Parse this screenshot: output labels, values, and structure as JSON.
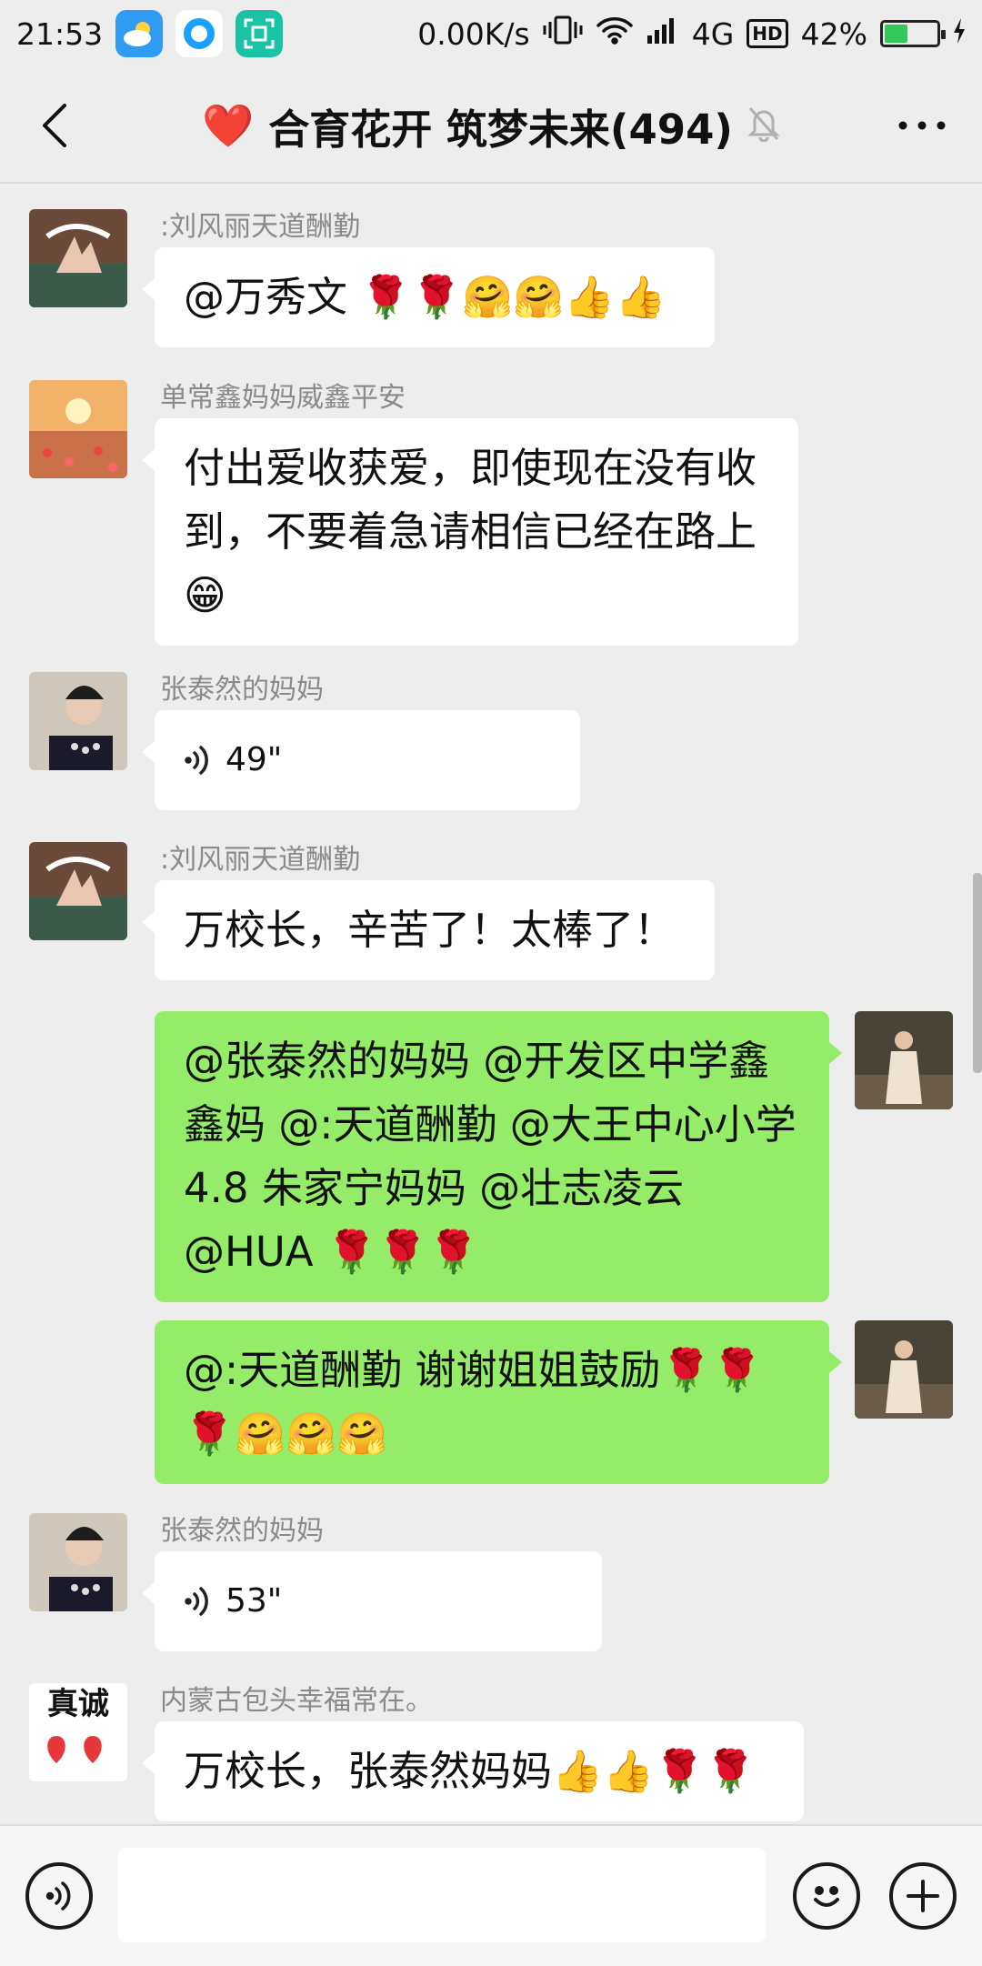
{
  "status_bar": {
    "time": "21:53",
    "net_speed": "0.00K/s",
    "network": "4G",
    "hd": "HD",
    "battery": "42%",
    "battery_level": 0.42
  },
  "header": {
    "title": "合育花开 筑梦未来(494)",
    "title_emoji": "❤️"
  },
  "messages": [
    {
      "side": "left",
      "sender": ":刘风丽天道酬勤",
      "text": "@万秀文 🌹🌹🤗🤗👍👍"
    },
    {
      "side": "left",
      "sender": "单常鑫妈妈威鑫平安",
      "text": "付出爱收获爱，即使现在没有收到，不要着急请相信已经在路上😁"
    },
    {
      "side": "left",
      "sender": "张泰然的妈妈",
      "voice": "49\""
    },
    {
      "side": "left",
      "sender": ":刘风丽天道酬勤",
      "text": "万校长，辛苦了！太棒了！"
    },
    {
      "side": "right",
      "text": "@张泰然的妈妈 @开发区中学鑫鑫妈 @:天道酬勤 @大王中心小学4.8 朱家宁妈妈 @壮志凌云 @HUA 🌹🌹🌹"
    },
    {
      "side": "right",
      "text": "@:天道酬勤  谢谢姐姐鼓励🌹🌹🌹🤗🤗🤗"
    },
    {
      "side": "left",
      "sender": "张泰然的妈妈",
      "voice": "53\""
    },
    {
      "side": "left",
      "sender": "内蒙古包头幸福常在。",
      "avatar_text": "真诚",
      "text": "万校长，张泰然妈妈👍👍🌹🌹"
    }
  ],
  "input_bar": {
    "placeholder": ""
  },
  "colors": {
    "background": "#ededed",
    "own_bubble": "#95ec69",
    "other_bubble": "#ffffff"
  }
}
